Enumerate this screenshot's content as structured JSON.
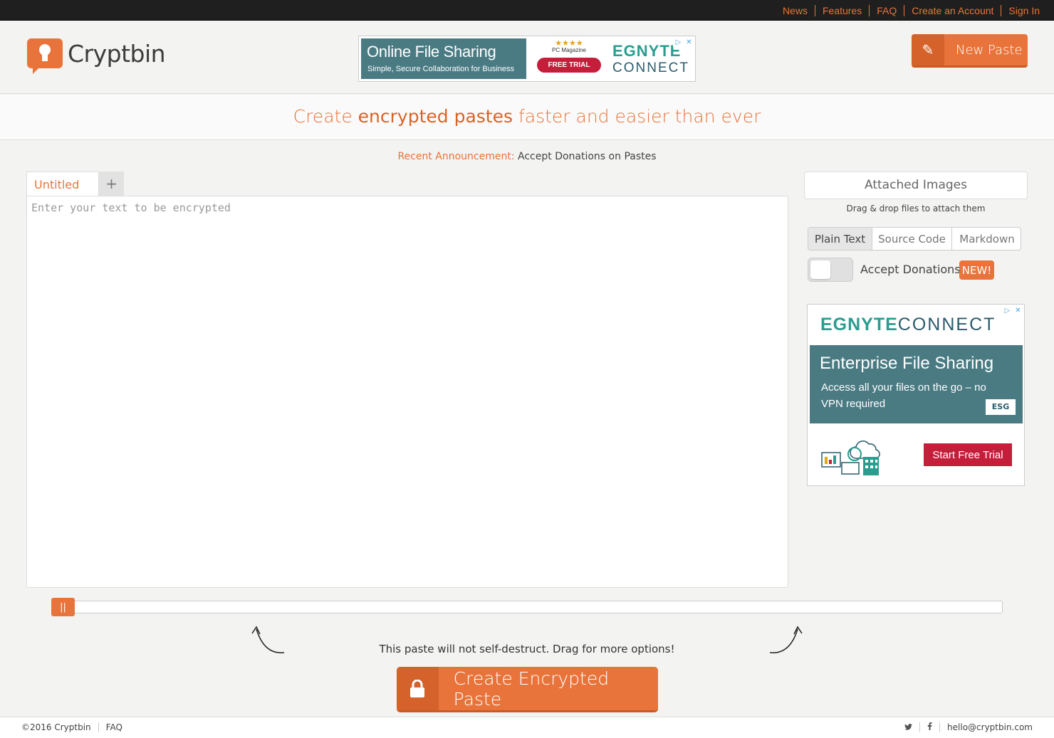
{
  "topnav": [
    "News",
    "Features",
    "FAQ",
    "Create an Account",
    "Sign In"
  ],
  "brand": {
    "name": "Cryptbin"
  },
  "header": {
    "new_paste_label": "New Paste"
  },
  "ad_top": {
    "title": "Online File Sharing",
    "subtitle": "Simple, Secure Collaboration for Business",
    "stars": "★★★★",
    "magazine": "PC Magazine",
    "trial": "FREE TRIAL",
    "brand_a": "EGNYTE",
    "brand_b": "CONNECT"
  },
  "tagline": {
    "pre": "Create ",
    "em": "encrypted pastes",
    "post": " faster and easier than ever"
  },
  "announce": {
    "key": "Recent Announcement:",
    "value": " Accept Donations on Pastes"
  },
  "tabs": {
    "active": "Untitled",
    "add": "+"
  },
  "editor": {
    "placeholder": "Enter your text to be encrypted"
  },
  "sidebar": {
    "attach_label": "Attached Images",
    "attach_hint": "Drag & drop files to attach them",
    "modes": [
      "Plain Text",
      "Source Code",
      "Markdown"
    ],
    "selected_mode": "Plain Text",
    "donations_label": "Accept Donations",
    "donations_enabled": false,
    "new_badge": "NEW!"
  },
  "ad_side": {
    "brand_a": "EGNYTE",
    "brand_b": "CONNECT",
    "title": "Enterprise File Sharing",
    "body": "Access all your files on the go – no VPN required",
    "badge": "ESG",
    "cta": "Start Free Trial"
  },
  "expire": {
    "message": "This paste will not self-destruct. Drag for more options!",
    "handle": "||"
  },
  "create_label": "Create Encrypted Paste",
  "footer": {
    "copyright": "©2016 Cryptbin",
    "faq": "FAQ",
    "email": "hello@cryptbin.com"
  },
  "colors": {
    "accent": "#e8743b",
    "topbar": "#1f1f1f",
    "ad_teal": "#4a7b83",
    "ad_red": "#c41e3a"
  },
  "icons": [
    "pencil-icon",
    "lock-icon",
    "twitter-icon",
    "facebook-icon",
    "plus-icon",
    "ad-choices-icon",
    "close-icon"
  ]
}
